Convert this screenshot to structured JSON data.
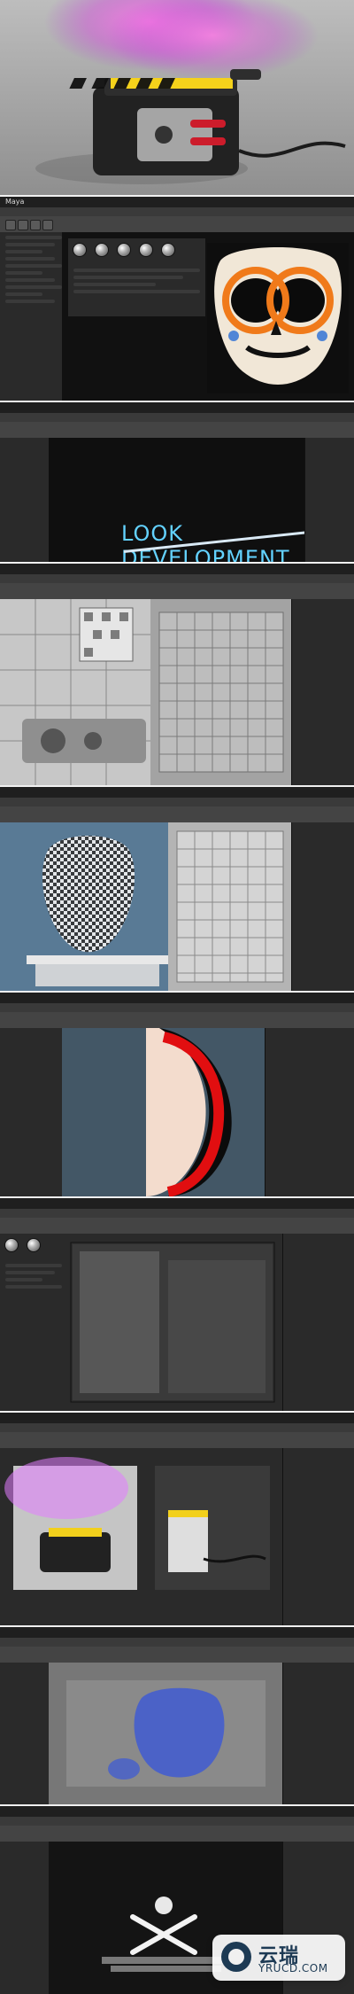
{
  "panels": {
    "p2": {
      "app_label": "Maya"
    },
    "p3": {
      "title_text": "LOOK DEVELOPMENT",
      "tag_text": "\\v"
    }
  },
  "watermark": {
    "cn": "云瑞",
    "en": "YRUCD.COM"
  }
}
